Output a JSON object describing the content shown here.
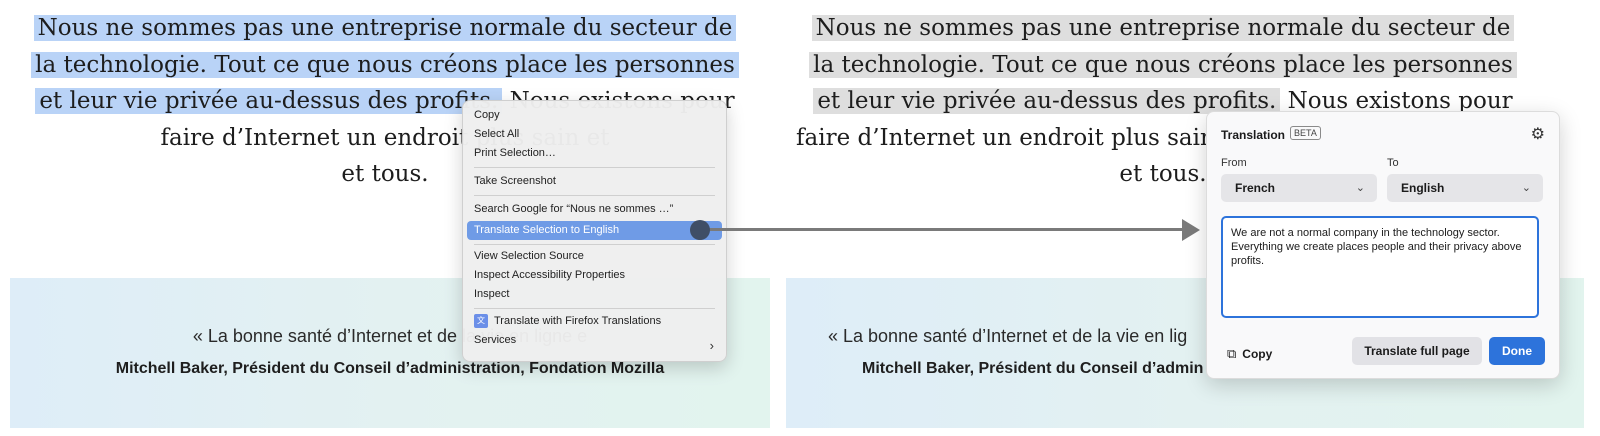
{
  "page": {
    "para_lines": [
      "Nous ne sommes pas une entreprise normale du secteur de",
      "la technologie. Tout ce que nous créons place les personnes",
      "et leur vie privée au-dessus des profits.",
      " Nous existons pour",
      "faire d’Internet un endroit plus sain et",
      "et tous."
    ],
    "para_line3_tail_left": " Nous existons pour",
    "para_line4_left": "faire d’Internet un endroit plus sain et",
    "para_line4_right": "faire d’Internet un endroit plus sain",
    "quote_text_left": "« La bonne santé d’Internet et de la vie en ligne e",
    "quote_text_right": "« La bonne santé d’Internet et de la vie en lig",
    "quote_author_left": "Mitchell Baker, Président du Conseil d’administration, Fondation Mozilla",
    "quote_author_right": "Mitchell Baker, Président du Conseil d’admin"
  },
  "context_menu": {
    "items": [
      "Copy",
      "Select All",
      "Print Selection…",
      "Take Screenshot",
      "Search Google for “Nous ne sommes …”",
      "Translate Selection to English",
      "View Selection Source",
      "Inspect Accessibility Properties",
      "Inspect",
      "Translate with Firefox Translations",
      "Services"
    ],
    "submenu_chevron": "›"
  },
  "translation_panel": {
    "title": "Translation",
    "beta_badge": "BETA",
    "from_label": "From",
    "to_label": "To",
    "from_value": "French",
    "to_value": "English",
    "output_text": "We are not a normal company in the technology sector. Everything we create places people and their privacy above profits.",
    "copy_label": "Copy",
    "translate_full_page_label": "Translate full page",
    "done_label": "Done",
    "accent_color": "#2d73db"
  },
  "icons": {
    "settings": "gear-icon",
    "copy": "copy-icon",
    "dropdown": "chevron-down-icon",
    "firefox_translations": "translations-icon",
    "pointer": "arrow-pointer"
  }
}
